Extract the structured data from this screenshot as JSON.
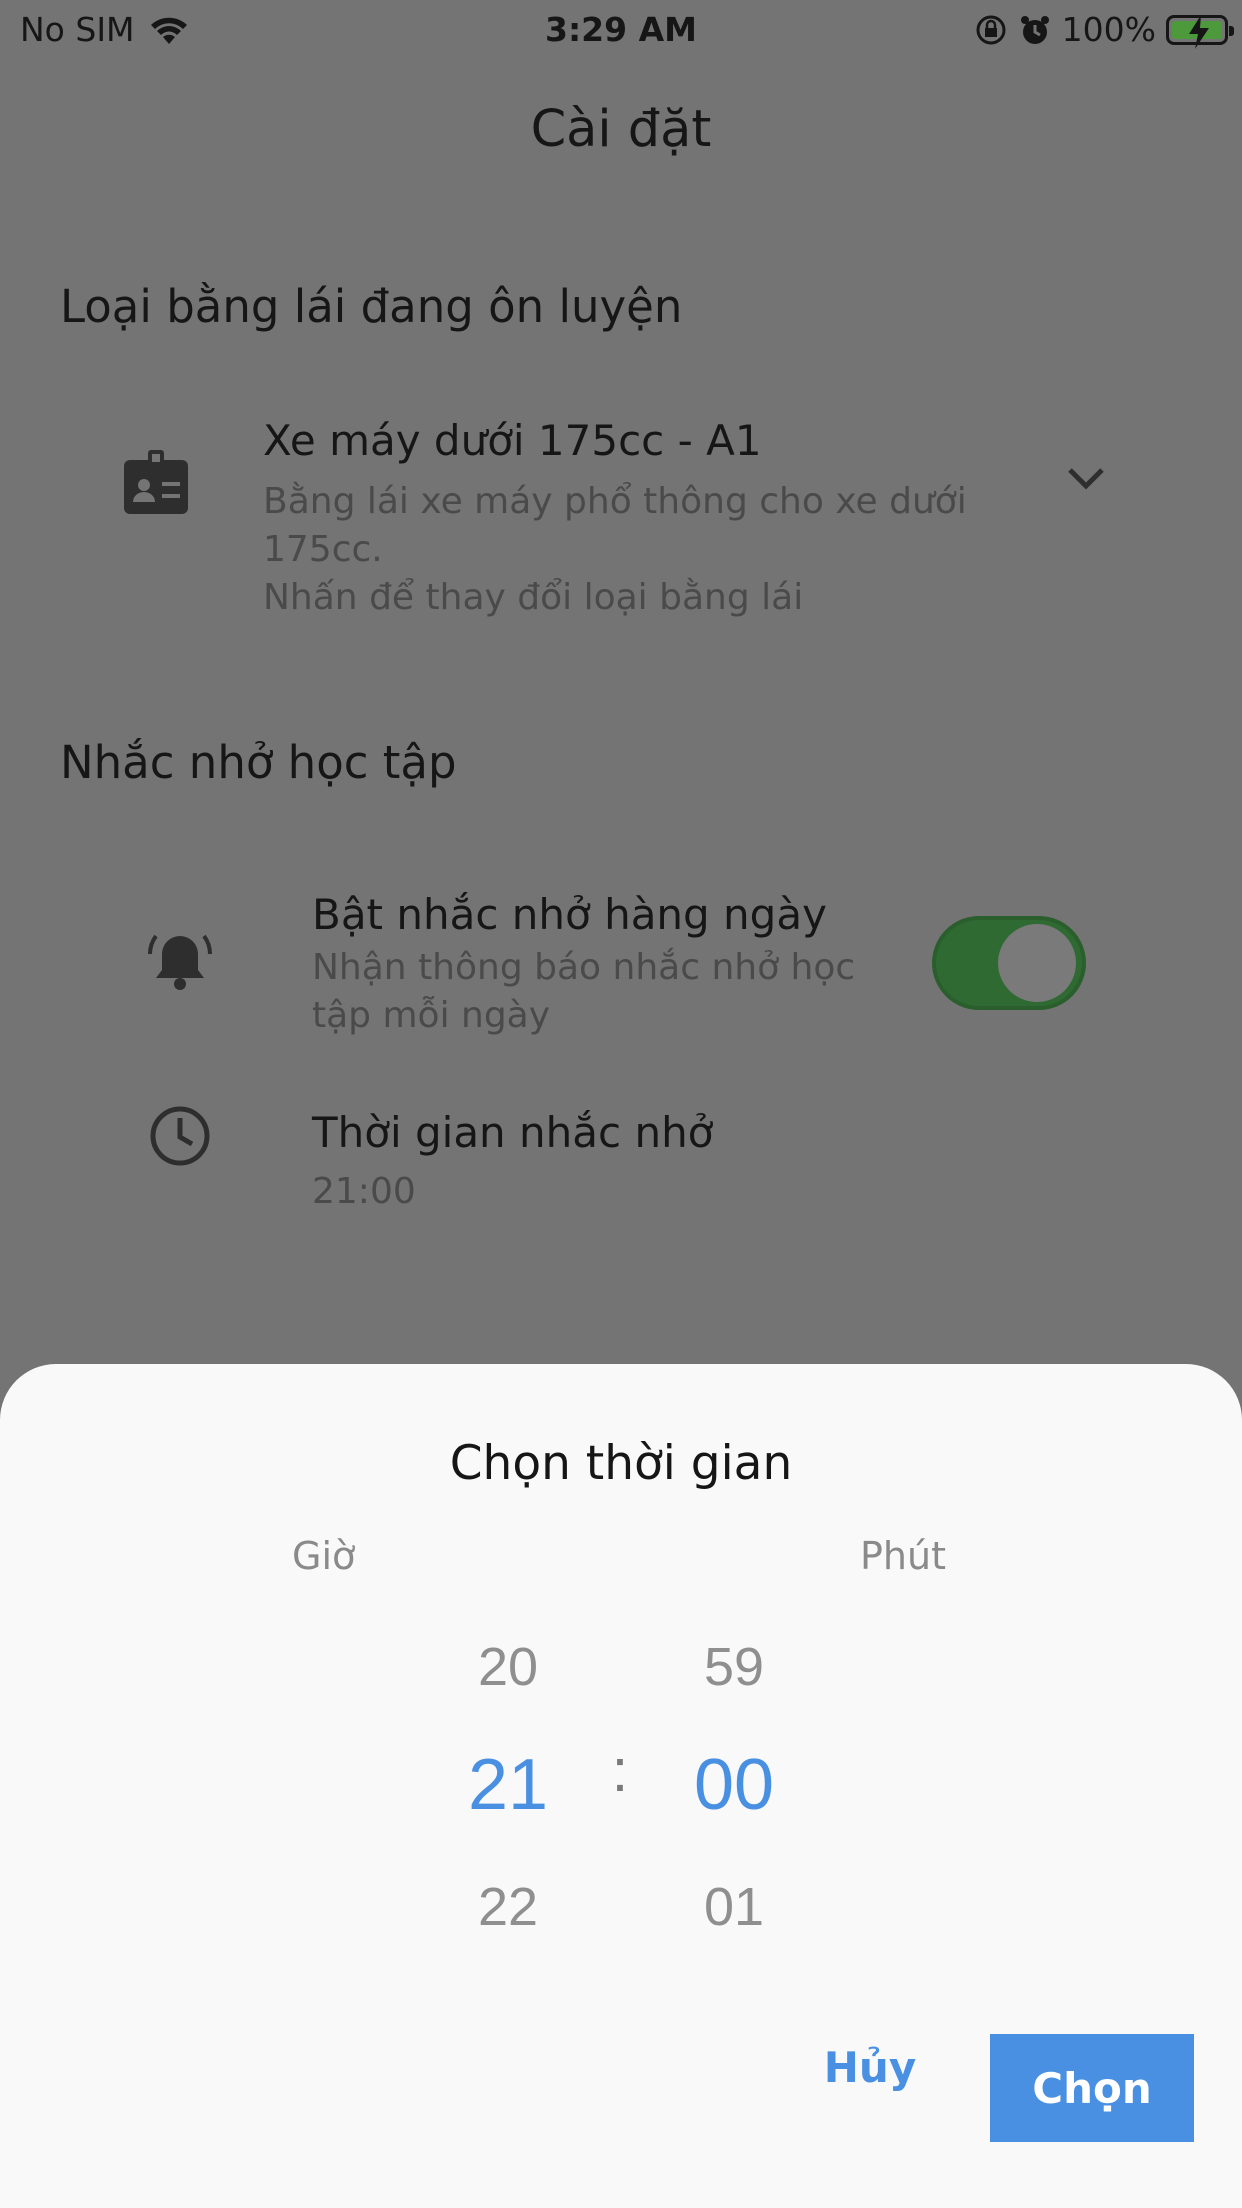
{
  "status_bar": {
    "carrier": "No SIM",
    "time": "3:29 AM",
    "battery": "100%"
  },
  "header": {
    "title": "Cài đặt"
  },
  "license_section": {
    "title": "Loại bằng lái đang ôn luyện",
    "item": {
      "icon": "id-badge-icon",
      "title": "Xe máy dưới 175cc - A1",
      "description_line1": "Bằng lái xe máy phổ thông cho xe dưới",
      "description_line2": "175cc.",
      "hint": "Nhấn để thay đổi loại bằng lái"
    }
  },
  "reminder_section": {
    "title": "Nhắc nhở học tập",
    "daily_toggle": {
      "icon": "bell-icon",
      "title": "Bật nhắc nhở hàng ngày",
      "description_line1": "Nhận thông báo nhắc nhở học",
      "description_line2": "tập mỗi ngày",
      "enabled": true,
      "accent": "#2f6a33"
    },
    "time_item": {
      "icon": "clock-icon",
      "title": "Thời gian nhắc nhở",
      "value": "21:00"
    }
  },
  "time_picker": {
    "title": "Chọn thời gian",
    "hour_label": "Giờ",
    "minute_label": "Phút",
    "hours": {
      "prev": "20",
      "selected": "21",
      "next": "22"
    },
    "minutes": {
      "prev": "59",
      "selected": "00",
      "next": "01"
    },
    "separator": ":",
    "cancel_label": "Hủy",
    "confirm_label": "Chọn",
    "accent": "#4a90e2"
  }
}
